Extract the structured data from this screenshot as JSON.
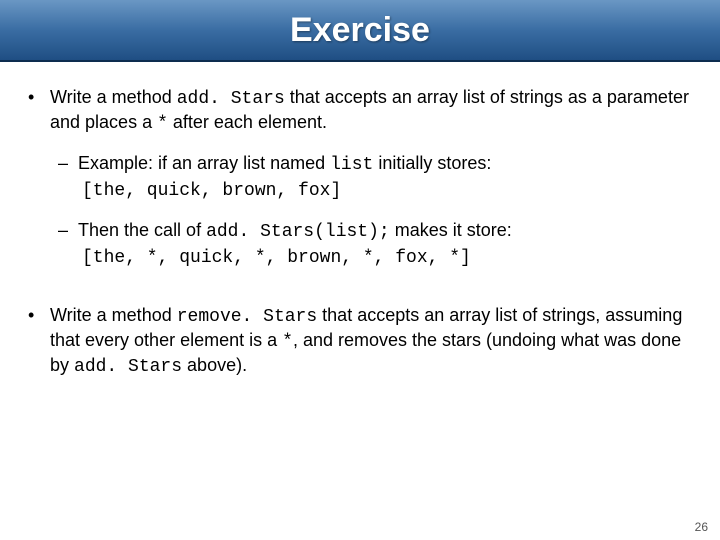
{
  "header": {
    "title": "Exercise"
  },
  "bullet1": {
    "pre": "Write a method ",
    "method": "add. Stars",
    "mid": " that accepts an array list of strings as a parameter and places a ",
    "star": "*",
    "post": " after each element."
  },
  "sub1": {
    "pre": "Example: if an array list named ",
    "code": "list",
    "post": " initially stores:"
  },
  "example1": "[the, quick, brown, fox]",
  "sub2": {
    "pre": "Then the call of ",
    "code": "add. Stars(list);",
    "post": "  makes it store:"
  },
  "example2": "[the, *, quick, *, brown, *, fox, *]",
  "bullet2": {
    "pre": "Write a method ",
    "method": "remove. Stars",
    "mid": " that accepts an array list of strings, assuming that every other element is a ",
    "star": "*",
    "mid2": ", and removes the stars (undoing what was done by ",
    "method2": "add. Stars",
    "post": " above)."
  },
  "page": "26"
}
